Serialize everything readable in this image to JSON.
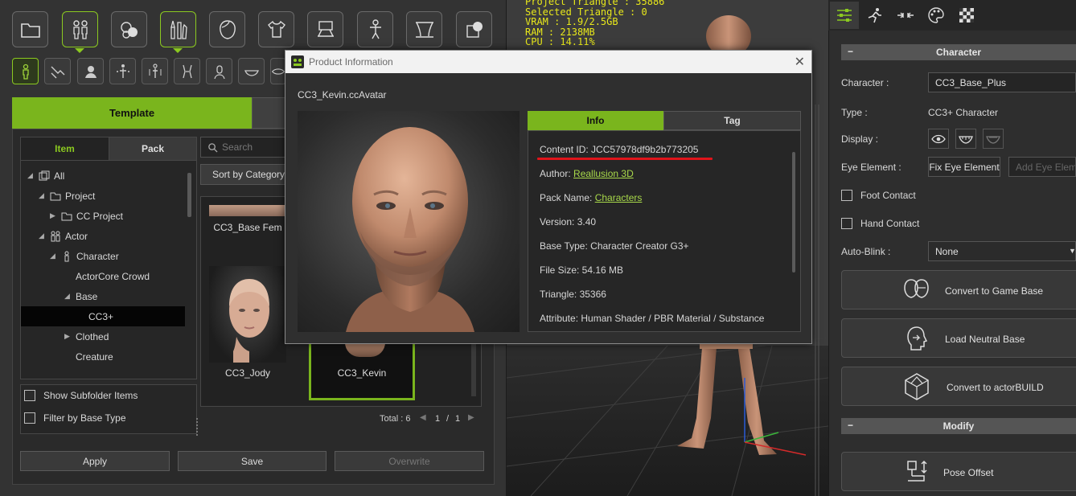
{
  "left": {
    "tab_template": "Template",
    "subtab_item": "Item",
    "subtab_pack": "Pack",
    "search_placeholder": "Search",
    "sort_label": "Sort by Category",
    "tree": [
      "All",
      "Project",
      "CC Project",
      "Actor",
      "Character",
      "ActorCore Crowd",
      "Base",
      "CC3+",
      "Clothed",
      "Creature"
    ],
    "checks": [
      "Show Subfolder Items",
      "Filter by Base Type"
    ],
    "cards": [
      "CC3_Base Fem",
      "CC3_Jody",
      "CC3_Kevin"
    ],
    "total": "Total : 6",
    "page": "1",
    "page_sep": "/",
    "page_total": "1",
    "buttons": [
      "Apply",
      "Save",
      "Overwrite"
    ]
  },
  "stats": {
    "text": "Project Triangle : 35886\nSelected Triangle : 0\nVRAM : 1.9/2.5GB\nRAM : 2138MB\nCPU : 14.11%"
  },
  "right": {
    "section_character": "Character",
    "section_modify": "Modify",
    "character_label": "Character :",
    "character_value": "CC3_Base_Plus",
    "type_label": "Type :",
    "type_value": "CC3+ Character",
    "display_label": "Display :",
    "eye_label": "Eye Element :",
    "eye_fix": "Fix Eye Element",
    "eye_add": "Add Eye Element",
    "foot_contact": "Foot Contact",
    "hand_contact": "Hand Contact",
    "autoblink_label": "Auto-Blink :",
    "autoblink_value": "None",
    "btn_game_base": "Convert to Game Base",
    "btn_neutral": "Load Neutral Base",
    "btn_actorbuild": "Convert to actorBUILD",
    "btn_pose_offset": "Pose Offset"
  },
  "dialog": {
    "title": "Product Information",
    "close": "✕",
    "file": "CC3_Kevin.ccAvatar",
    "tab_info": "Info",
    "tab_tag": "Tag",
    "content_id": "Content ID: JCC57978df9b2b773205",
    "author_label": "Author: ",
    "author_value": "Reallusion 3D",
    "pack_label": "Pack Name: ",
    "pack_value": "Characters",
    "version": "Version: 3.40",
    "base_type": "Base Type: Character Creator G3+",
    "file_size": "File Size: 54.16 MB",
    "triangle": "Triangle: 35366",
    "attribute": "Attribute: Human Shader / PBR Material / Substance"
  },
  "colors": {
    "accent": "#7ab51d",
    "highlight_line": "#e0141b",
    "stats_text": "#e8e81a"
  }
}
